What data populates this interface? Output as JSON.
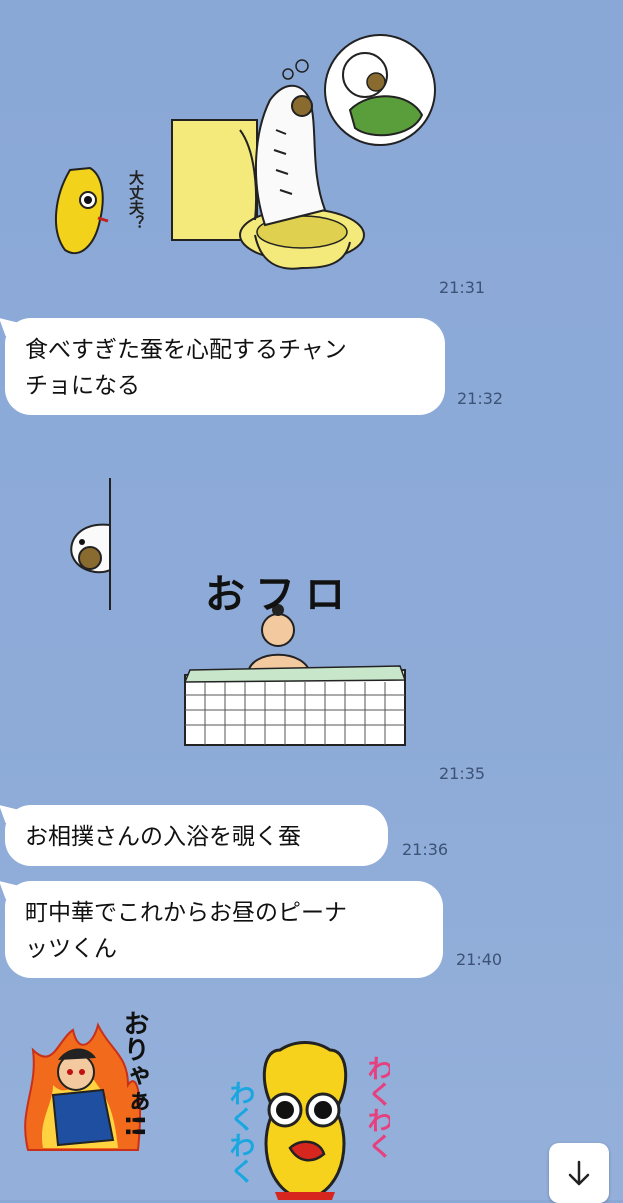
{
  "messages": [
    {
      "id": "m1",
      "kind": "sticker",
      "sticker": "silkworm-toilet-sticker",
      "caption": "大丈夫？",
      "time": "21:31"
    },
    {
      "id": "m2",
      "kind": "text",
      "lines": [
        "食べすぎた蚕を心配するチャン",
        "チョになる"
      ],
      "time": "21:32"
    },
    {
      "id": "m3",
      "kind": "sticker",
      "sticker": "ofuro-sumo-sticker",
      "caption": "おフロ",
      "time": "21:35"
    },
    {
      "id": "m4",
      "kind": "text",
      "lines": [
        "お相撲さんの入浴を覗く蚕"
      ],
      "time": "21:36"
    },
    {
      "id": "m5",
      "kind": "text",
      "lines": [
        "町中華でこれからお昼のピーナ",
        "ッツくん"
      ],
      "time": "21:40"
    },
    {
      "id": "m6",
      "kind": "sticker",
      "sticker": "oriya-fire-sticker",
      "caption": "おりゃぁ!!"
    },
    {
      "id": "m7",
      "kind": "sticker",
      "sticker": "peanut-wakuwaku-sticker",
      "caption_left": "わくわく",
      "caption_right": "わくわく"
    }
  ],
  "scroll_button": {
    "icon": "arrow-down-icon"
  }
}
